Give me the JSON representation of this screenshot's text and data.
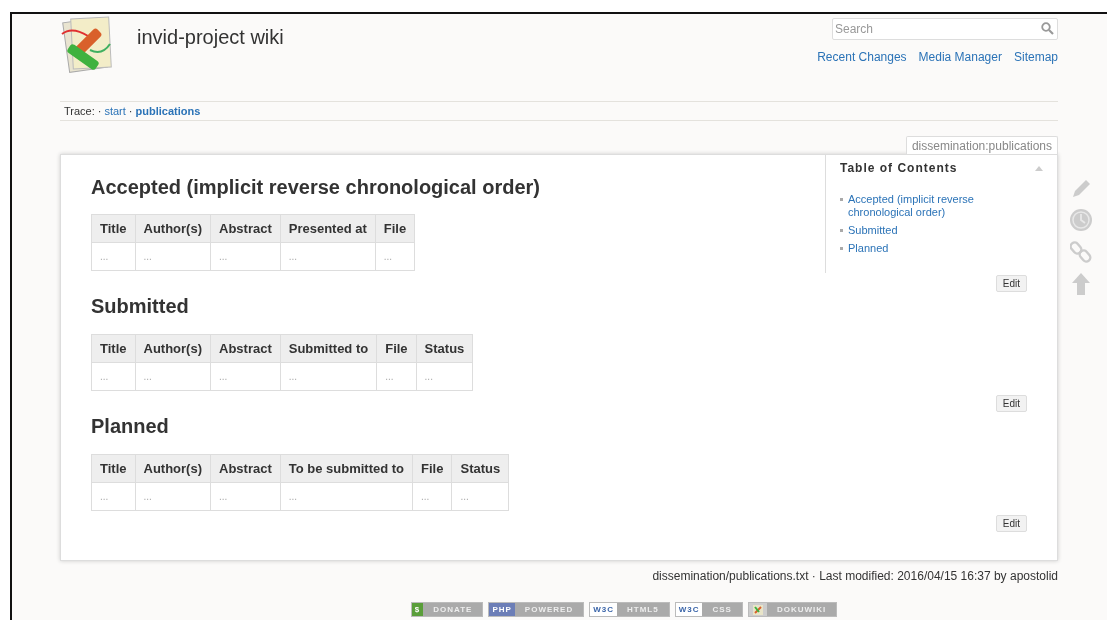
{
  "site": {
    "title": "invid-project wiki",
    "search": {
      "placeholder": "Search"
    },
    "links": [
      "Recent Changes",
      "Media Manager",
      "Sitemap"
    ]
  },
  "breadcrumb": {
    "label": "Trace:",
    "separator": "·",
    "items": [
      {
        "label": "start",
        "current": false
      },
      {
        "label": "publications",
        "current": true
      }
    ]
  },
  "page_id": "dissemination:publications",
  "toc": {
    "title": "Table of Contents",
    "expanded": true,
    "items": [
      "Accepted (implicit reverse chronological order)",
      "Submitted",
      "Planned"
    ]
  },
  "sections": [
    {
      "heading": "Accepted (implicit reverse chronological order)",
      "kind": "main",
      "columns": [
        "Title",
        "Author(s)",
        "Abstract",
        "Presented at",
        "File"
      ],
      "rows": [
        [
          "...",
          "...",
          "...",
          "...",
          "..."
        ]
      ],
      "edit": "Edit"
    },
    {
      "heading": "Submitted",
      "kind": "sub",
      "columns": [
        "Title",
        "Author(s)",
        "Abstract",
        "Submitted to",
        "File",
        "Status"
      ],
      "rows": [
        [
          "...",
          "...",
          "...",
          "...",
          "...",
          "..."
        ]
      ],
      "edit": "Edit"
    },
    {
      "heading": "Planned",
      "kind": "sub",
      "columns": [
        "Title",
        "Author(s)",
        "Abstract",
        "To be submitted to",
        "File",
        "Status"
      ],
      "rows": [
        [
          "...",
          "...",
          "...",
          "...",
          "...",
          "..."
        ]
      ],
      "edit": "Edit"
    }
  ],
  "footer": "dissemination/publications.txt · Last modified: 2016/04/15 16:37 by apostolid",
  "badges": [
    {
      "kind": "donate",
      "prefix": "$",
      "label": "DONATE"
    },
    {
      "kind": "php",
      "prefix": "PHP",
      "label": "POWERED"
    },
    {
      "kind": "w3c",
      "prefix": "W3C",
      "label": "HTML5"
    },
    {
      "kind": "w3c",
      "prefix": "W3C",
      "label": "CSS"
    },
    {
      "kind": "dokuwiki",
      "label": "DOKUWIKI"
    }
  ]
}
